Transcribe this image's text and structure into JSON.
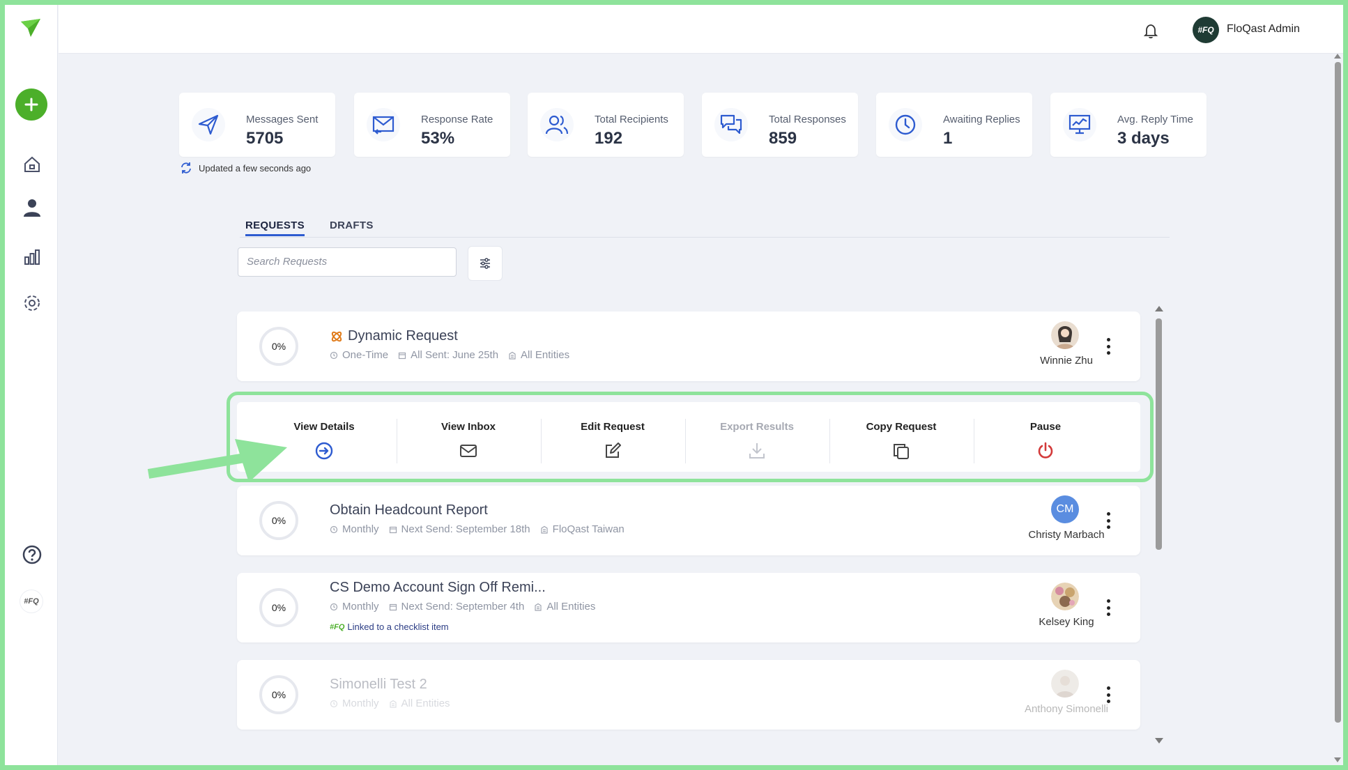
{
  "topbar": {
    "user_name": "FloQast Admin",
    "avatar_initials": "#FQ"
  },
  "sidebar": {
    "items": [
      {
        "icon": "home-icon"
      },
      {
        "icon": "user-icon"
      },
      {
        "icon": "bar-chart-icon"
      },
      {
        "icon": "gear-icon"
      }
    ],
    "fq_badge": "#FQ"
  },
  "stats": [
    {
      "label": "Messages Sent",
      "value": "5705",
      "icon": "send-icon"
    },
    {
      "label": "Response Rate",
      "value": "53%",
      "icon": "mail-reply-icon"
    },
    {
      "label": "Total Recipients",
      "value": "192",
      "icon": "users-icon"
    },
    {
      "label": "Total Responses",
      "value": "859",
      "icon": "chat-icon"
    },
    {
      "label": "Awaiting Replies",
      "value": "1",
      "icon": "clock-icon"
    },
    {
      "label": "Avg. Reply Time",
      "value": "3 days",
      "icon": "monitor-chart-icon"
    }
  ],
  "updated_text": "Updated a few seconds ago",
  "tabs": [
    {
      "label": "REQUESTS",
      "active": true
    },
    {
      "label": "DRAFTS",
      "active": false
    }
  ],
  "search": {
    "placeholder": "Search Requests"
  },
  "requests": [
    {
      "progress": "0%",
      "title": "Dynamic Request",
      "frequency": "One-Time",
      "send_info": "All Sent: June 25th",
      "entity": "All Entities",
      "owner": "Winnie Zhu"
    },
    {
      "progress": "0%",
      "title": "Obtain Headcount Report",
      "frequency": "Monthly",
      "send_info": "Next Send: September 18th",
      "entity": "FloQast Taiwan",
      "owner": "Christy Marbach",
      "owner_initials": "CM"
    },
    {
      "progress": "0%",
      "title": "CS Demo Account Sign Off Remi...",
      "frequency": "Monthly",
      "send_info": "Next Send: September 4th",
      "entity": "All Entities",
      "linked": "Linked to a checklist item",
      "owner": "Kelsey King"
    },
    {
      "progress": "0%",
      "title": "Simonelli Test 2",
      "frequency": "Monthly",
      "entity": "All Entities",
      "owner": "Anthony Simonelli"
    }
  ],
  "actions": [
    {
      "label": "View Details",
      "icon": "arrow-right-circle-icon",
      "enabled": true
    },
    {
      "label": "View Inbox",
      "icon": "envelope-icon",
      "enabled": true
    },
    {
      "label": "Edit Request",
      "icon": "edit-icon",
      "enabled": true
    },
    {
      "label": "Export Results",
      "icon": "download-icon",
      "enabled": false
    },
    {
      "label": "Copy Request",
      "icon": "copy-icon",
      "enabled": true
    },
    {
      "label": "Pause",
      "icon": "power-icon",
      "enabled": true
    }
  ],
  "colors": {
    "accent": "#2d5bd0",
    "brand_green": "#4caf2a",
    "highlight": "#8ee39b",
    "pause_red": "#d33a3a"
  }
}
